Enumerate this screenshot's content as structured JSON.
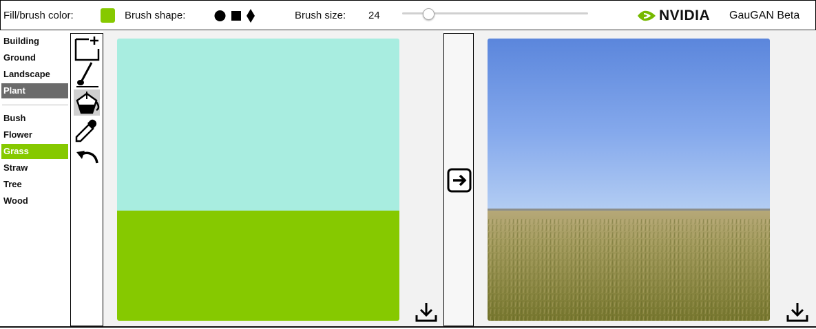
{
  "toolbar": {
    "fill_label": "Fill/brush color:",
    "fill_color": "#86c900",
    "shape_label": "Brush shape:",
    "shapes": [
      "circle-icon",
      "square-icon",
      "diamond-icon"
    ],
    "size_label": "Brush size:",
    "size_value": "24",
    "size_slider_fraction": 0.12,
    "brand": "NVIDIA",
    "brand_color": "#76b900",
    "app_title": "GauGAN Beta"
  },
  "labels": {
    "group1": [
      {
        "label": "Building"
      },
      {
        "label": "Ground"
      },
      {
        "label": "Landscape"
      },
      {
        "label": "Plant",
        "selected": true
      }
    ],
    "group2": [
      {
        "label": "Bush"
      },
      {
        "label": "Flower"
      },
      {
        "label": "Grass",
        "selected": true
      },
      {
        "label": "Straw"
      },
      {
        "label": "Tree"
      },
      {
        "label": "Wood"
      }
    ]
  },
  "tools": [
    "new-canvas-icon",
    "brush-icon",
    "paint-bucket-icon",
    "eyedropper-icon",
    "undo-icon"
  ],
  "active_tool": "paint-bucket-icon",
  "canvas": {
    "sky_color": "#a8ede0",
    "ground_color": "#86c900"
  },
  "icons": {
    "download": "download-icon",
    "generate": "arrow-right-icon"
  }
}
